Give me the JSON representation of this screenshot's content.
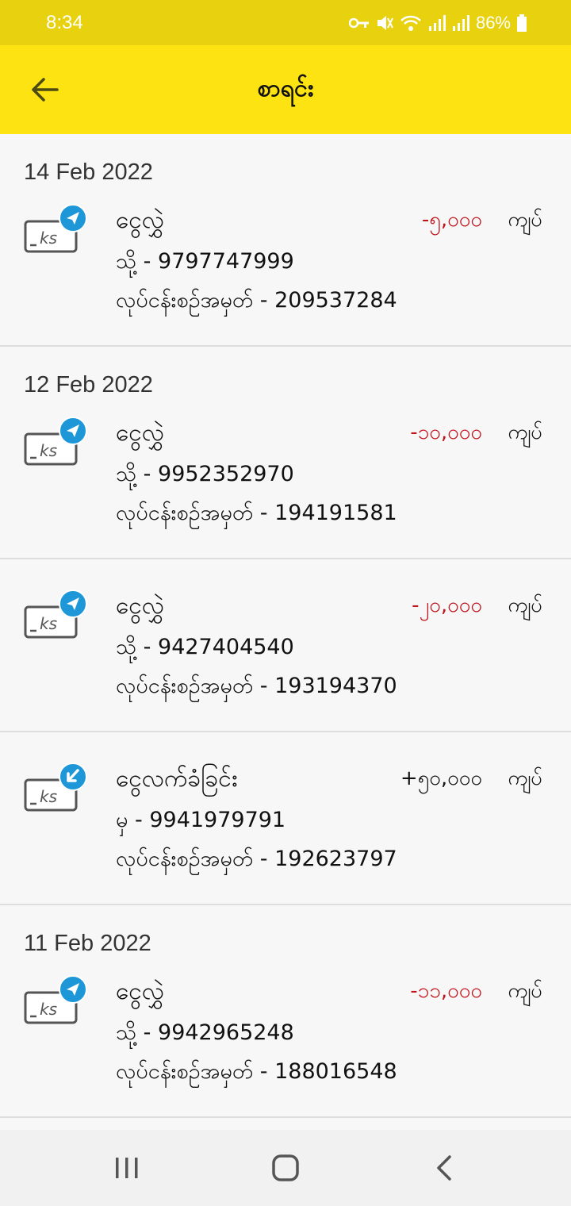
{
  "status_bar": {
    "time": "8:34",
    "battery": "86%"
  },
  "app_bar": {
    "title": "စာရင်း"
  },
  "groups": [
    {
      "date": "14 Feb 2022",
      "transactions": [
        {
          "type": "ငွေလွှဲ",
          "direction": "sent",
          "amount": "-၅,၀၀၀",
          "currency": "ကျပ်",
          "party": "သို့ - 9797747999",
          "txid": "လုပ်ငန်းစဉ်အမှတ် - 209537284"
        }
      ]
    },
    {
      "date": "12 Feb 2022",
      "transactions": [
        {
          "type": "ငွေလွှဲ",
          "direction": "sent",
          "amount": "-၁၀,၀၀၀",
          "currency": "ကျပ်",
          "party": "သို့ - 9952352970",
          "txid": "လုပ်ငန်းစဉ်အမှတ် - 194191581"
        },
        {
          "type": "ငွေလွှဲ",
          "direction": "sent",
          "amount": "-၂၀,၀၀၀",
          "currency": "ကျပ်",
          "party": "သို့ - 9427404540",
          "txid": "လုပ်ငန်းစဉ်အမှတ် - 193194370"
        },
        {
          "type": "ငွေလက်ခံခြင်း",
          "direction": "received",
          "amount": "+၅၀,၀၀၀",
          "currency": "ကျပ်",
          "party": "မှ - 9941979791",
          "txid": "လုပ်ငန်းစဉ်အမှတ် - 192623797"
        }
      ]
    },
    {
      "date": "11 Feb 2022",
      "transactions": [
        {
          "type": "ငွေလွှဲ",
          "direction": "sent",
          "amount": "-၁၁,၀၀၀",
          "currency": "ကျပ်",
          "party": "သို့ - 9942965248",
          "txid": "လုပ်ငန်းစဉ်အမှတ် - 188016548"
        }
      ]
    }
  ],
  "icons": {
    "back": "arrow-left-icon",
    "sent": "send-icon",
    "received": "receive-icon",
    "wallet": "kyat-wallet-icon",
    "nav_recent": "recent-apps-icon",
    "nav_home": "home-icon",
    "nav_back": "back-chevron-icon"
  },
  "colors": {
    "status_bar": "#e8d20f",
    "app_bar": "#fde311",
    "negative_amount": "#c0121b",
    "badge": "#1e97d8"
  }
}
